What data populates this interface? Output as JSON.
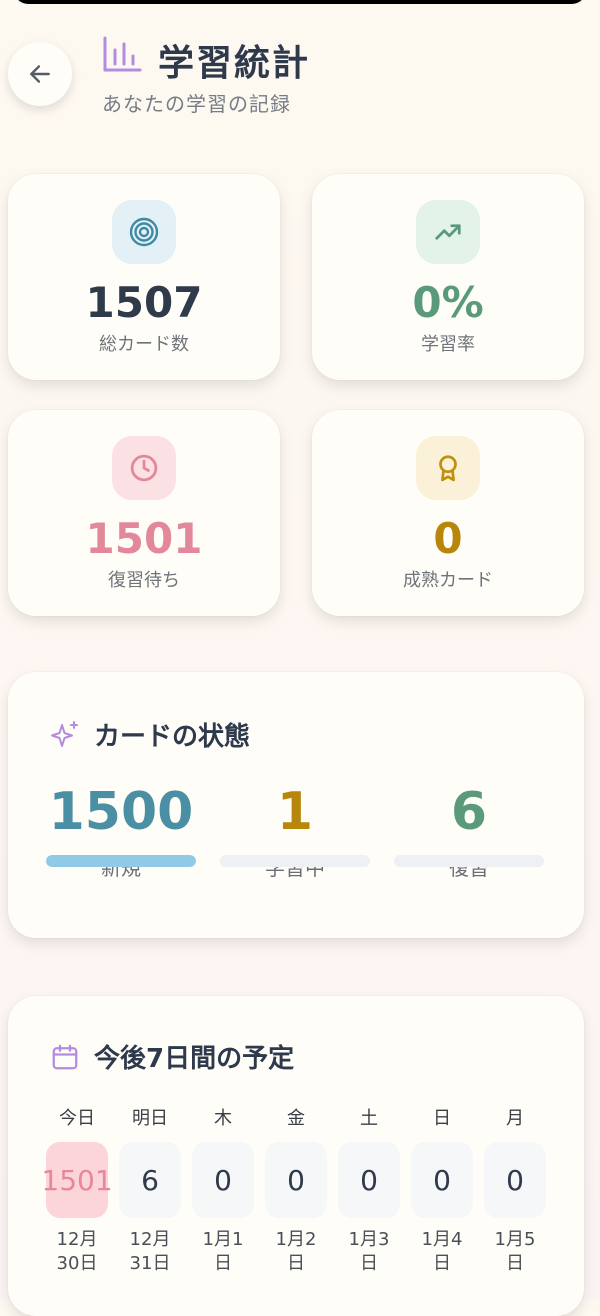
{
  "header": {
    "title": "学習統計",
    "subtitle": "あなたの学習の記録"
  },
  "stats": [
    {
      "value": "1507",
      "label": "総カード数",
      "icon": "target-icon",
      "color": "#2f3a4a",
      "icon_bg": "#e3f1f6",
      "icon_color": "#3f8aa3"
    },
    {
      "value": "0%",
      "label": "学習率",
      "icon": "trending-up-icon",
      "color": "#5a9a7a",
      "icon_bg": "#e3f3ea",
      "icon_color": "#5a9a7a"
    },
    {
      "value": "1501",
      "label": "復習待ち",
      "icon": "clock-icon",
      "color": "#e3889a",
      "icon_bg": "#fbe0e4",
      "icon_color": "#e3889a"
    },
    {
      "value": "0",
      "label": "成熟カード",
      "icon": "award-icon",
      "color": "#b8860b",
      "icon_bg": "#fbf1d8",
      "icon_color": "#c0910f"
    }
  ],
  "card_state": {
    "title": "カードの状態",
    "items": [
      {
        "value": "1500",
        "label": "新規",
        "color": "#4a8fa3",
        "fill": 1.0,
        "bar_color": "#8fcbe6"
      },
      {
        "value": "1",
        "label": "学習中",
        "color": "#b8860b",
        "fill": 0.0,
        "bar_color": "#e9c46a"
      },
      {
        "value": "6",
        "label": "復習",
        "color": "#5a9a7a",
        "fill": 0.0,
        "bar_color": "#9bd3b5"
      }
    ]
  },
  "schedule": {
    "title": "今後7日間の予定",
    "days": [
      {
        "name": "今日",
        "count": "1501",
        "date1": "12月",
        "date2": "30日",
        "today": true
      },
      {
        "name": "明日",
        "count": "6",
        "date1": "12月",
        "date2": "31日",
        "today": false
      },
      {
        "name": "木",
        "count": "0",
        "date1": "1月1",
        "date2": "日",
        "today": false
      },
      {
        "name": "金",
        "count": "0",
        "date1": "1月2",
        "date2": "日",
        "today": false
      },
      {
        "name": "土",
        "count": "0",
        "date1": "1月3",
        "date2": "日",
        "today": false
      },
      {
        "name": "日",
        "count": "0",
        "date1": "1月4",
        "date2": "日",
        "today": false
      },
      {
        "name": "月",
        "count": "0",
        "date1": "1月5",
        "date2": "日",
        "today": false
      }
    ]
  },
  "colors": {
    "accent_purple": "#b48be0"
  }
}
